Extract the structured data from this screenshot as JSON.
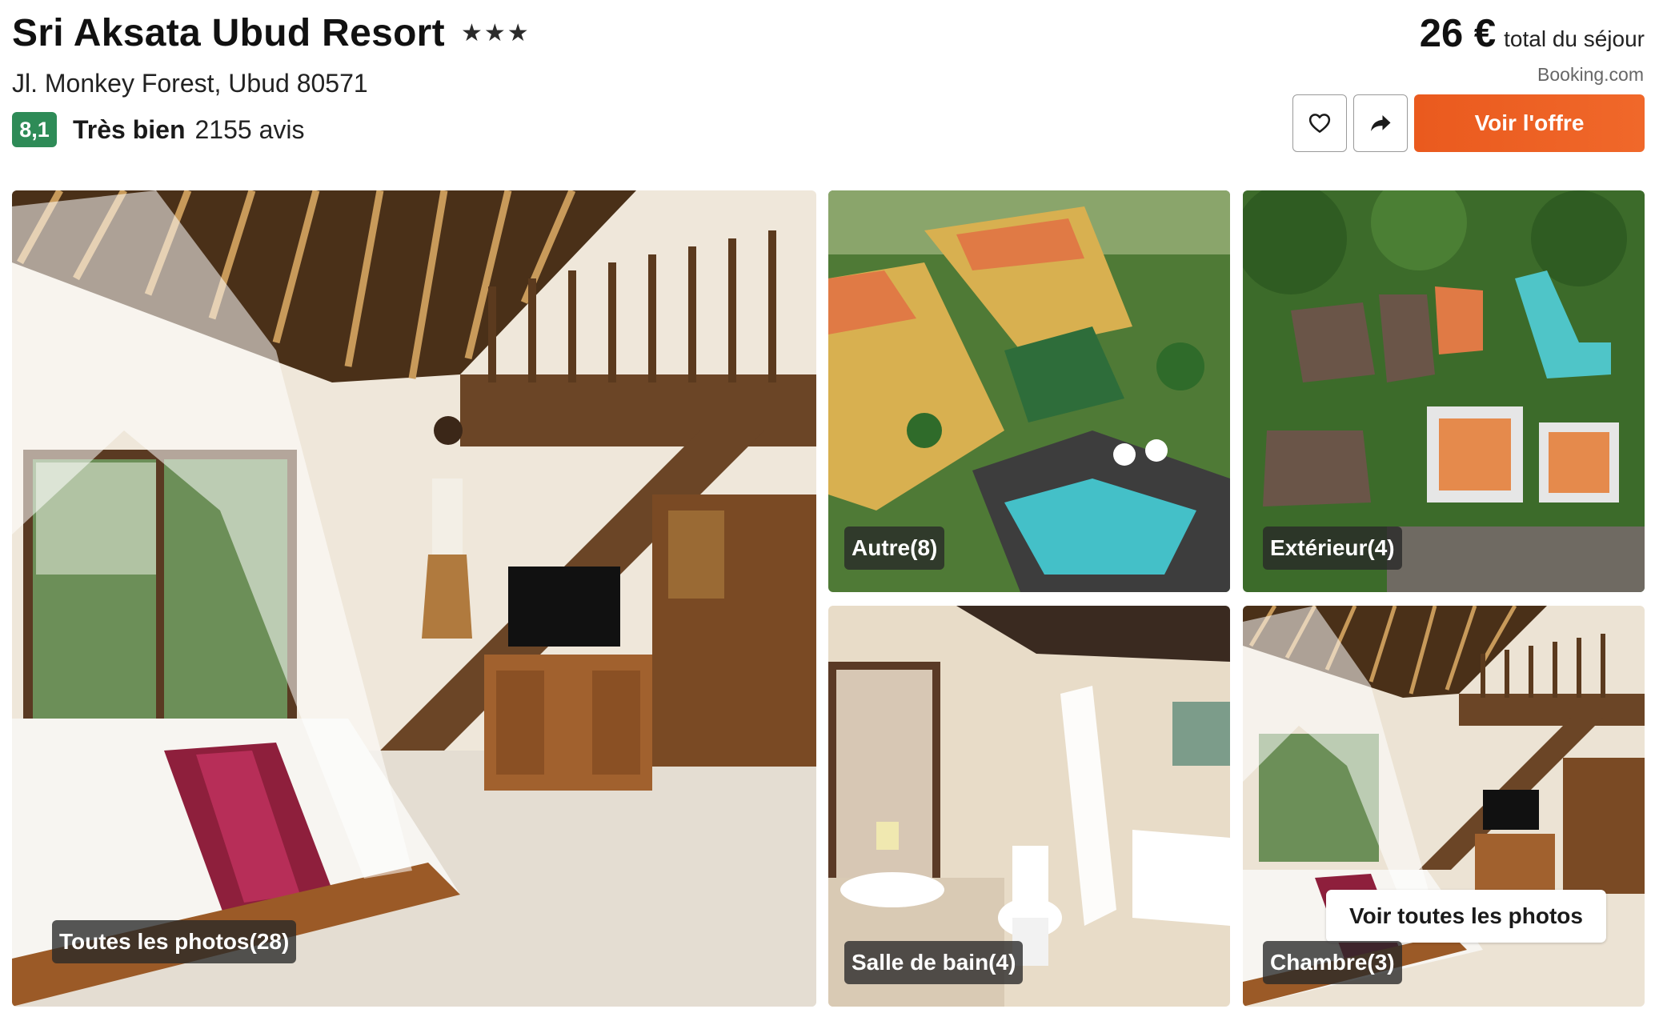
{
  "header": {
    "hotel_name": "Sri Aksata Ubud Resort",
    "star_rating": 3,
    "stars_display": [
      "★",
      "★",
      "★"
    ],
    "address": "Jl. Monkey Forest, Ubud 80571",
    "score": "8,1",
    "rating_label": "Très bien",
    "reviews": "2155 avis"
  },
  "pricing": {
    "price": "26 €",
    "note": "total du séjour",
    "provider": "Booking.com",
    "offer_button": "Voir l'offre",
    "favorite_icon": "heart-icon",
    "share_icon": "share-arrow-icon"
  },
  "gallery": {
    "main_label": "Toutes les photos(28)",
    "tiles": [
      {
        "label": "Autre(8)",
        "scene": "aerial-hotel-pool"
      },
      {
        "label": "Extérieur(4)",
        "scene": "aerial-roofs-jungle"
      },
      {
        "label": "Salle de bain(4)",
        "scene": "bathroom"
      },
      {
        "label": "Chambre(3)",
        "scene": "bedroom-loft"
      }
    ],
    "see_all_button": "Voir toutes les photos"
  },
  "colors": {
    "score_badge": "#2e8b57",
    "offer_button": "#ea5a1e",
    "chip_background": "#282828"
  }
}
